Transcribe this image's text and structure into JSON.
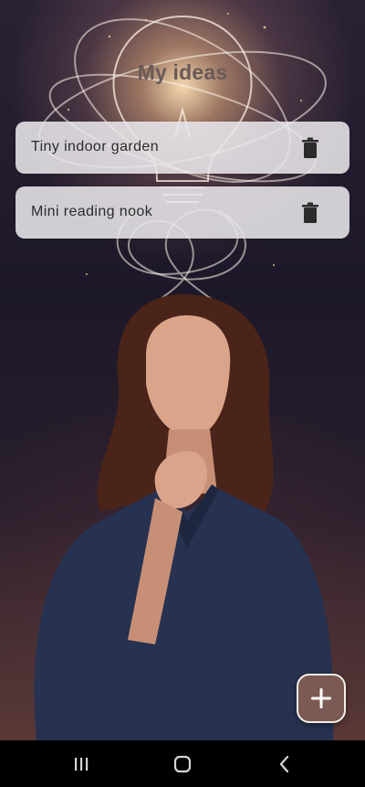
{
  "app": {
    "title": "My ideas"
  },
  "ideas": [
    {
      "label": "Tiny indoor garden"
    },
    {
      "label": "Mini reading nook"
    }
  ],
  "icons": {
    "delete": "trash-icon",
    "add": "plus-icon",
    "recents": "recents-icon",
    "home": "home-icon",
    "back": "back-icon"
  },
  "colors": {
    "fab_bg": "#7a5a52",
    "card_bg": "#e8e6eb",
    "title_text": "#6a5a58"
  }
}
